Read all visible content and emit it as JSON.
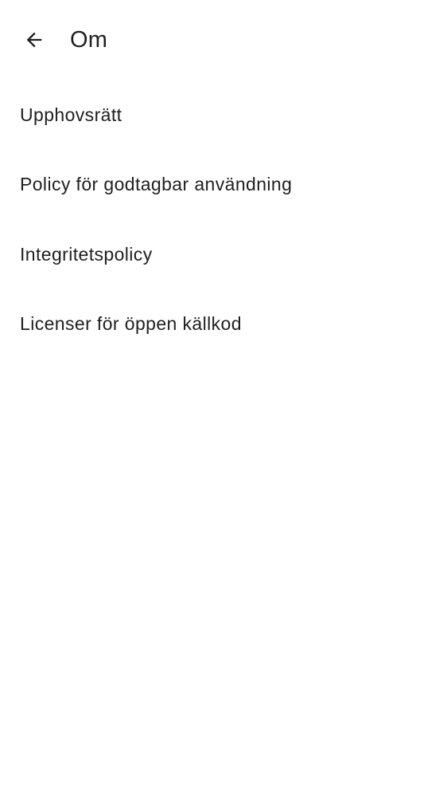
{
  "header": {
    "title": "Om",
    "back_icon": "arrow-back-icon"
  },
  "menu": {
    "items": [
      {
        "label": "Upphovsrätt"
      },
      {
        "label": "Policy för godtagbar användning"
      },
      {
        "label": "Integritetspolicy"
      },
      {
        "label": "Licenser för öppen källkod"
      }
    ]
  },
  "colors": {
    "background": "#ffffff",
    "text": "#1f1f1f"
  }
}
